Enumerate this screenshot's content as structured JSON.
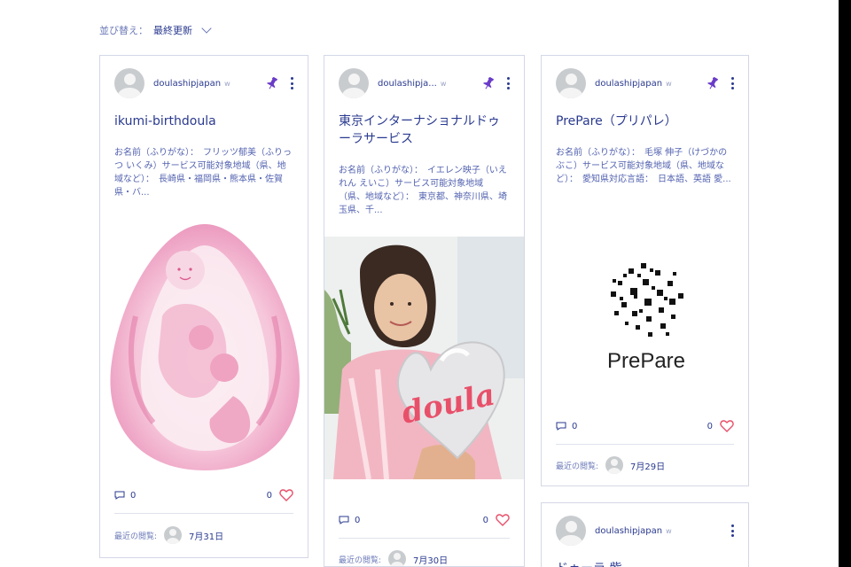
{
  "sort": {
    "label": "並び替え：",
    "value": "最終更新"
  },
  "cards": [
    {
      "author": "doulashipjapan",
      "badge": "w",
      "title": "ikumi-birthdoula",
      "excerpt": "お名前（ふりがな）：　フリッツ郁美（ふりっつ いくみ）サービス可能対象地域（県、地域など）：　長崎県・福岡県・熊本県・佐賀県・バ...",
      "comments": "0",
      "likes": "0",
      "recent_label": "最近の閲覧:",
      "recent_date": "7月31日"
    },
    {
      "author": "doulashipja...",
      "badge": "w",
      "title": "東京インターナショナルドゥーラサービス",
      "excerpt": "お名前（ふりがな）：　イエレン映子（いえれん えいこ）サービス可能対象地域（県、地域など）：　東京都、神奈川県、埼玉県、千...",
      "media_text": "doula",
      "comments": "0",
      "likes": "0",
      "recent_label": "最近の閲覧:",
      "recent_date": "7月30日"
    },
    {
      "author": "doulashipjapan",
      "badge": "w",
      "title": "PrePare（プリパレ）",
      "excerpt": "お名前（ふりがな）：　毛塚 伸子（けづかのぶこ）サービス可能対象地域（県、地域など）：　愛知県対応言語：　日本語、英語 愛...",
      "media_text": "PrePare",
      "comments": "0",
      "likes": "0",
      "recent_label": "最近の閲覧:",
      "recent_date": "7月29日"
    },
    {
      "author": "doulashipjapan",
      "badge": "w",
      "title": "ドゥーラ 紫"
    }
  ],
  "colors": {
    "accent": "#2a3a8f",
    "pin": "#6a3cc8",
    "heart": "#e8506a"
  }
}
